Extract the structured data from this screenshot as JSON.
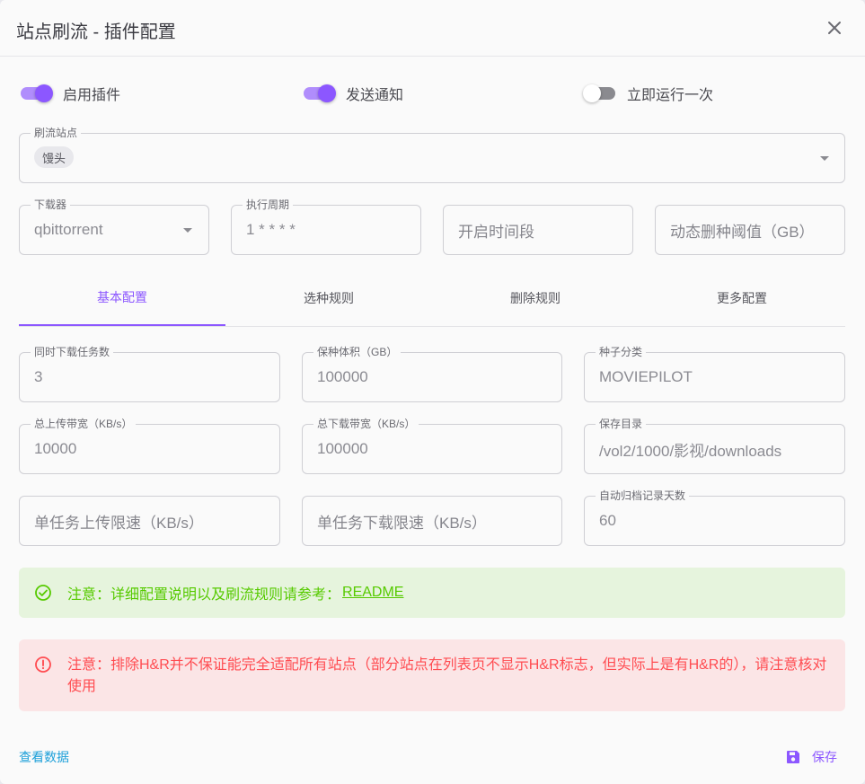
{
  "dialog": {
    "title": "站点刷流 - 插件配置"
  },
  "switches": [
    {
      "label": "启用插件",
      "on": true
    },
    {
      "label": "发送通知",
      "on": true
    },
    {
      "label": "立即运行一次",
      "on": false
    }
  ],
  "sites": {
    "legend": "刷流站点",
    "chips": [
      "馒头"
    ]
  },
  "row2": {
    "downloader": {
      "legend": "下载器",
      "value": "qbittorrent"
    },
    "cron": {
      "legend": "执行周期",
      "value": "1 * * * *"
    },
    "active_time": {
      "placeholder": "开启时间段"
    },
    "delete_threshold": {
      "placeholder": "动态删种阈值（GB）"
    }
  },
  "tabs": [
    "基本配置",
    "选种规则",
    "删除规则",
    "更多配置"
  ],
  "basic": {
    "max_downloads": {
      "legend": "同时下载任务数",
      "value": "3"
    },
    "seed_size": {
      "legend": "保种体积（GB）",
      "value": "100000"
    },
    "category": {
      "legend": "种子分类",
      "value": "MOVIEPILOT"
    },
    "up_speed": {
      "legend": "总上传带宽（KB/s）",
      "value": "10000"
    },
    "dl_speed": {
      "legend": "总下载带宽（KB/s）",
      "value": "100000"
    },
    "save_path": {
      "legend": "保存目录",
      "value": "/vol2/1000/影视/downloads"
    },
    "task_up_limit": {
      "placeholder": "单任务上传限速（KB/s）"
    },
    "task_dl_limit": {
      "placeholder": "单任务下载限速（KB/s）"
    },
    "archive_days": {
      "legend": "自动归档记录天数",
      "value": "60"
    }
  },
  "alerts": {
    "success_text": "注意：详细配置说明以及刷流规则请参考：",
    "success_link": "README",
    "error_text": "注意：排除H&R并不保证能完全适配所有站点（部分站点在列表页不显示H&R标志，但实际上是有H&R的），请注意核对使用"
  },
  "footer": {
    "view_data": "查看数据",
    "save": "保存"
  },
  "colors": {
    "primary": "#8c57ff",
    "success": "#56ca00",
    "error": "#ff4c51",
    "info": "#1ea0d9"
  },
  "icons": {
    "close": "close-icon",
    "save": "floppy-disk-icon",
    "success": "check-circle-icon",
    "error": "alert-circle-icon"
  }
}
